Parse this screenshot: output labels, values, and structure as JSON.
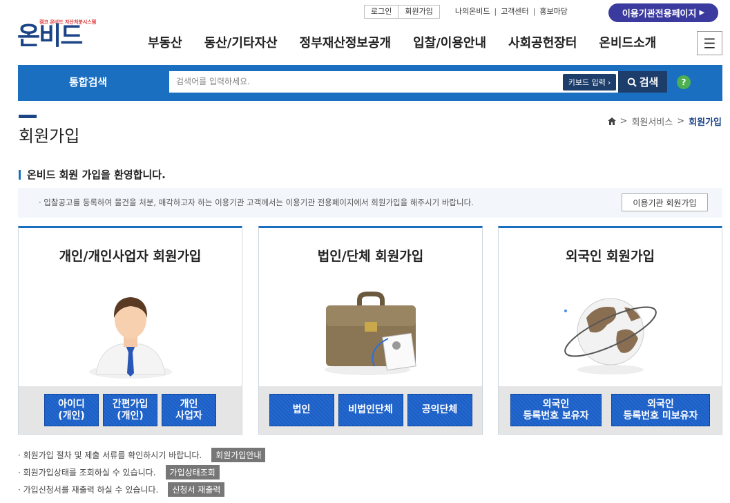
{
  "util": {
    "login": "로그인",
    "signup": "회원가입",
    "links": [
      "나의온비드",
      "고객센터",
      "홍보마당"
    ],
    "org_page": "이용기관전용페이지"
  },
  "logo": {
    "sub": "캠코 온비드 자산처분시스템",
    "main": "온비드"
  },
  "gnb": [
    "부동산",
    "동산/기타자산",
    "정부재산정보공개",
    "입찰/이용안내",
    "사회공헌장터",
    "온비드소개"
  ],
  "search": {
    "title": "통합검색",
    "placeholder": "검색어를 입력하세요.",
    "keyboard": "키보드 입력",
    "button": "검색",
    "help": "?"
  },
  "page": {
    "title": "회원가입",
    "breadcrumb": [
      "회원서비스",
      "회원가입"
    ],
    "welcome": "온비드 회원 가입을 환영합니다.",
    "notice": "· 입찰공고를 등록하여 물건을 처분, 매각하고자 하는 이용기관 고객께서는 이용기관 전용페이지에서 회원가입을 해주시기 바랍니다.",
    "org_join": "이용기관 회원가입"
  },
  "cards": [
    {
      "title": "개인/개인사업자 회원가입",
      "buttons": [
        "아이디\n(개인)",
        "간편가입\n(개인)",
        "개인\n사업자"
      ]
    },
    {
      "title": "법인/단체 회원가입",
      "buttons": [
        "법인",
        "비법인단체",
        "공익단체"
      ]
    },
    {
      "title": "외국인 회원가입",
      "buttons": [
        "외국인\n등록번호 보유자",
        "외국인\n등록번호 미보유자"
      ]
    }
  ],
  "notes": [
    {
      "text": "· 회원가입 절차 및 제출 서류를 확인하시기 바랍니다.",
      "tag": "회원가입안내"
    },
    {
      "text": "· 회원가입상태를 조회하실 수 있습니다.",
      "tag": "가입상태조회"
    },
    {
      "text": "· 가입신청서를 재출력 하실 수 있습니다.",
      "tag": "신청서 재출력"
    }
  ],
  "colors": {
    "brand_blue": "#1a6fc1",
    "navy": "#1c4587",
    "org_purple": "#3b3a9e"
  }
}
